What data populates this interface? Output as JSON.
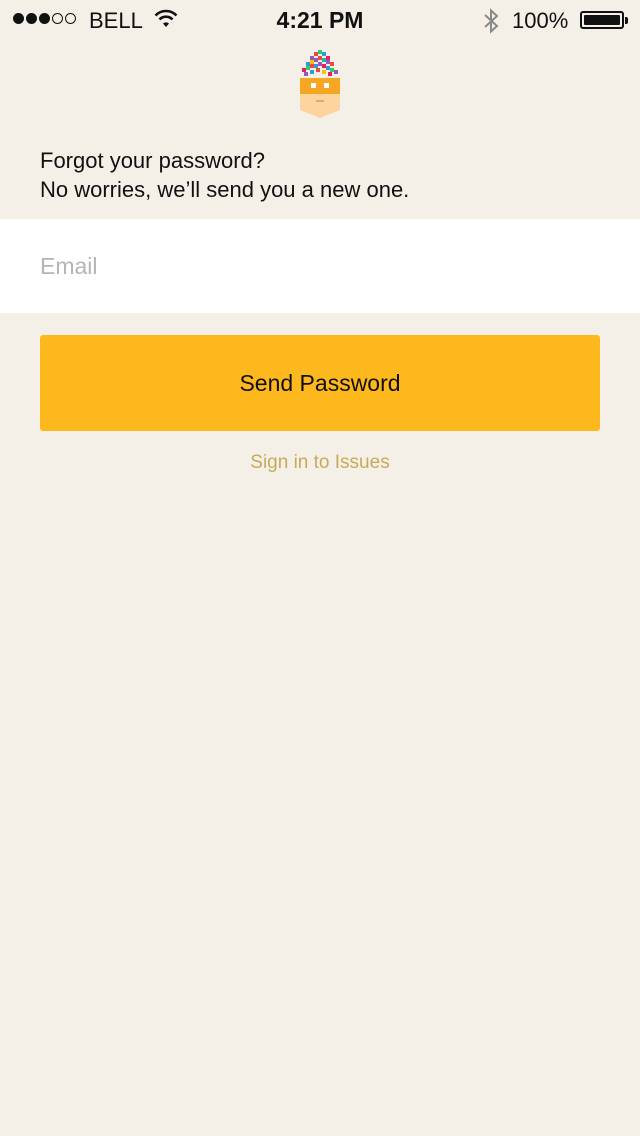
{
  "status_bar": {
    "carrier": "BELL",
    "time": "4:21 PM",
    "battery": "100%",
    "signal_bars_filled": 3,
    "signal_bars_total": 5
  },
  "icons": {
    "logo": "pixel-head-logo-icon",
    "wifi": "wifi-icon",
    "bluetooth": "bluetooth-icon",
    "battery": "battery-icon"
  },
  "colors": {
    "background": "#f4f0e8",
    "button": "#fdb81d",
    "link": "#c9a95a",
    "placeholder": "#b5b5b5"
  },
  "forgot": {
    "line1": "Forgot your password?",
    "line2": "No worries, we’ll send you a new one."
  },
  "email": {
    "placeholder": "Email",
    "value": ""
  },
  "send_button": {
    "label": "Send Password"
  },
  "signin_link": {
    "label": "Sign in to Issues"
  }
}
